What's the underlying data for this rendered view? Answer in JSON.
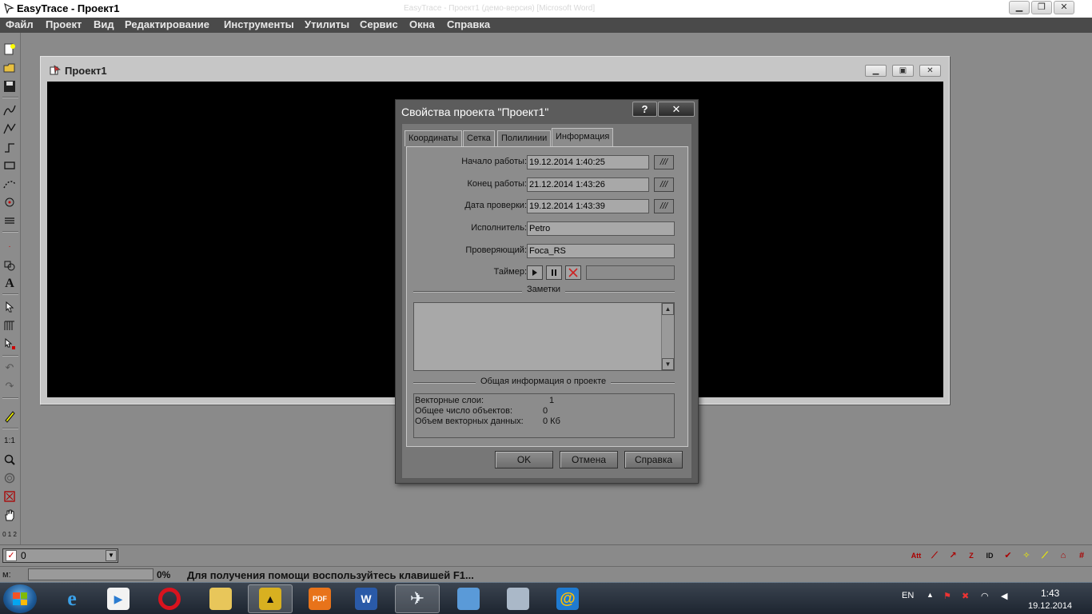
{
  "app": {
    "title": "EasyTrace - Проект1",
    "background_title": "EasyTrace - Проект1 (демо-версия) [Microsoft Word]"
  },
  "menu": [
    "Файл",
    "Проект",
    "Вид",
    "Редактирование",
    "Инструменты",
    "Утилиты",
    "Сервис",
    "Окна",
    "Справка"
  ],
  "mdi": {
    "title": "Проект1"
  },
  "dialog": {
    "title": "Свойства проекта \"Проект1\"",
    "help_btn": "?",
    "close_btn": "✕",
    "tabs": [
      "Координаты",
      "Сетка",
      "Полилинии",
      "Информация"
    ],
    "active_tab": "Информация",
    "rows": {
      "start_label": "Начало работы:",
      "start_value": "19.12.2014 1:40:25",
      "end_label": "Конец работы:",
      "end_value": "21.12.2014 1:43:26",
      "check_label": "Дата проверки:",
      "check_value": "19.12.2014 1:43:39",
      "executor_label": "Исполнитель:",
      "executor_value": "Petro",
      "checker_label": "Проверяющий:",
      "checker_value": "Foca_RS",
      "timer_label": "Таймер:",
      "dots": "///"
    },
    "notes_caption": "Заметки",
    "info_caption": "Общая информация о проекте",
    "info": {
      "layers_label": "Векторные слои:",
      "layers_value": "1",
      "objects_label": "Общее число объектов:",
      "objects_value": "0",
      "volume_label": "Объем векторных данных:",
      "volume_value": "0 Кб"
    },
    "buttons": {
      "ok": "OK",
      "cancel": "Отмена",
      "help": "Справка"
    }
  },
  "layerbar": {
    "layer_value": "0"
  },
  "statusbar": {
    "m_label": "м:",
    "percent": "0%",
    "help_text": "Для получения помощи воспользуйтесь клавишей F1..."
  },
  "taskbar": {
    "lang": "EN",
    "time": "1:43",
    "date": "19.12.2014"
  },
  "colors": {
    "workspace": "#8a8a8a",
    "dialog": "#5c5c5c",
    "canvas": "#000000",
    "taskbar": "#1d2530"
  }
}
